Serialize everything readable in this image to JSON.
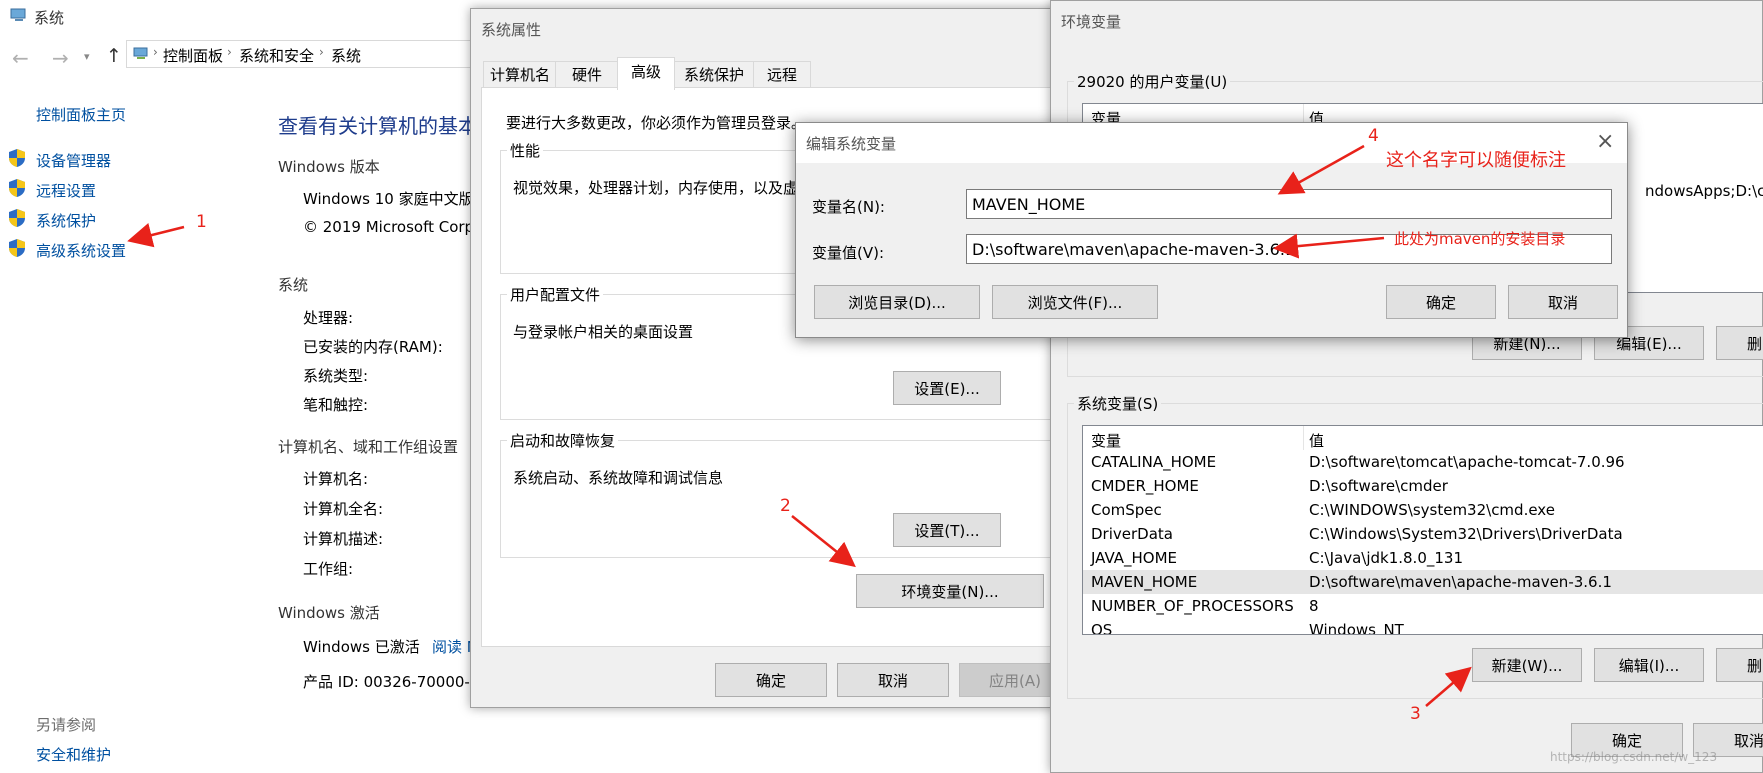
{
  "system_window": {
    "title": "系统",
    "breadcrumb": [
      "控制面板",
      "系统和安全",
      "系统"
    ],
    "sidebar": {
      "home": "控制面板主页",
      "items": [
        "设备管理器",
        "远程设置",
        "系统保护",
        "高级系统设置"
      ],
      "see_also": "另请参阅",
      "security": "安全和维护"
    },
    "heading": "查看有关计算机的基本",
    "windows_edition": {
      "label": "Windows 版本",
      "edition": "Windows 10 家庭中文版",
      "copyright": "© 2019 Microsoft Corp"
    },
    "system": {
      "label": "系统",
      "fields": [
        "处理器:",
        "已安装的内存(RAM):",
        "系统类型:",
        "笔和触控:"
      ]
    },
    "computer_name": {
      "label": "计算机名、域和工作组设置",
      "fields": [
        "计算机名:",
        "计算机全名:",
        "计算机描述:",
        "工作组:"
      ]
    },
    "activation": {
      "label": "Windows 激活",
      "status": "Windows 已激活",
      "read_link": "阅读 M",
      "product_id": "产品 ID: 00326-70000-0"
    }
  },
  "system_properties": {
    "title": "系统属性",
    "tabs": [
      "计算机名",
      "硬件",
      "高级",
      "系统保护",
      "远程"
    ],
    "active_tab": "高级",
    "admin_note": "要进行大多数更改，你必须作为管理员登录。",
    "performance": {
      "title": "性能",
      "desc": "视觉效果，处理器计划，内存使用，以及虚"
    },
    "user_profiles": {
      "title": "用户配置文件",
      "desc": "与登录帐户相关的桌面设置",
      "button": "设置(E)..."
    },
    "startup": {
      "title": "启动和故障恢复",
      "desc": "系统启动、系统故障和调试信息",
      "button": "设置(T)..."
    },
    "env_button": "环境变量(N)...",
    "ok": "确定",
    "cancel": "取消",
    "apply": "应用(A)"
  },
  "env_vars": {
    "title": "环境变量",
    "user_group": "29020 的用户变量(U)",
    "col_var": "变量",
    "col_val": "值",
    "user_partial_value": "ndowsApps;D:\\co",
    "user_buttons": [
      "新建(N)...",
      "编辑(E)...",
      "删除"
    ],
    "system_group": "系统变量(S)",
    "system_rows": [
      {
        "name": "CATALINA_HOME",
        "value": "D:\\software\\tomcat\\apache-tomcat-7.0.96"
      },
      {
        "name": "CMDER_HOME",
        "value": "D:\\software\\cmder"
      },
      {
        "name": "ComSpec",
        "value": "C:\\WINDOWS\\system32\\cmd.exe"
      },
      {
        "name": "DriverData",
        "value": "C:\\Windows\\System32\\Drivers\\DriverData"
      },
      {
        "name": "JAVA_HOME",
        "value": "C:\\Java\\jdk1.8.0_131"
      },
      {
        "name": "MAVEN_HOME",
        "value": "D:\\software\\maven\\apache-maven-3.6.1"
      },
      {
        "name": "NUMBER_OF_PROCESSORS",
        "value": "8"
      },
      {
        "name": "OS",
        "value": "Windows_NT"
      }
    ],
    "selected_row": "MAVEN_HOME",
    "system_buttons": [
      "新建(W)...",
      "编辑(I)...",
      "删除"
    ],
    "ok": "确定",
    "cancel": "取消"
  },
  "edit_dialog": {
    "title": "编辑系统变量",
    "name_label": "变量名(N):",
    "name_value": "MAVEN_HOME",
    "value_label": "变量值(V):",
    "value_value": "D:\\software\\maven\\apache-maven-3.6.1",
    "browse_dir": "浏览目录(D)...",
    "browse_file": "浏览文件(F)...",
    "ok": "确定",
    "cancel": "取消"
  },
  "annotations": {
    "n1": "1",
    "n2": "2",
    "n3": "3",
    "n4": "4",
    "note_name": "这个名字可以随便标注",
    "note_value": "此处为maven的安装目录",
    "color": "#e8221a"
  },
  "watermark": "https://blog.csdn.net/w_123"
}
